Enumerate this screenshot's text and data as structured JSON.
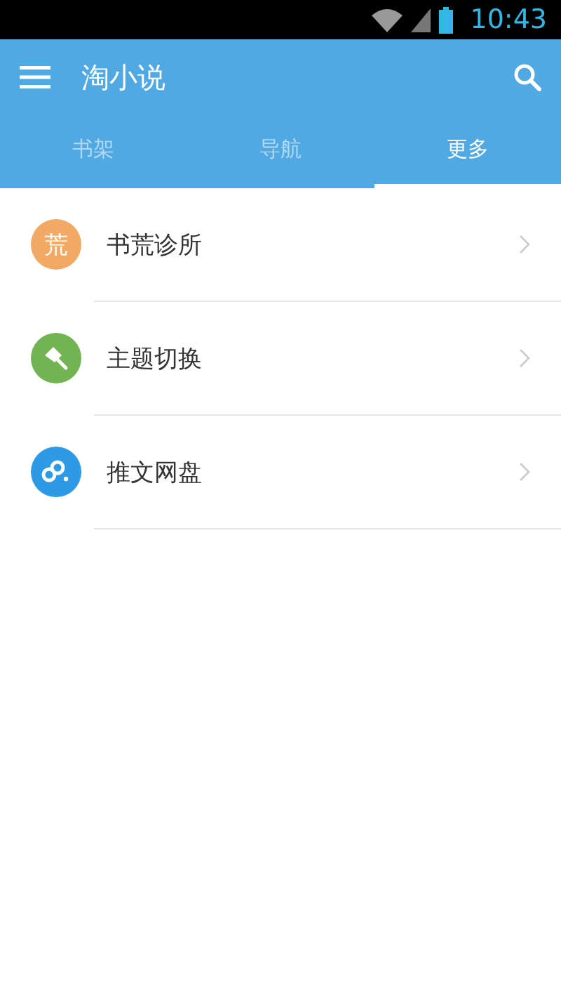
{
  "status_bar": {
    "time": "10:43"
  },
  "app_bar": {
    "title": "淘小说"
  },
  "tabs": [
    {
      "label": "书架",
      "selected": false
    },
    {
      "label": "导航",
      "selected": false
    },
    {
      "label": "更多",
      "selected": true
    }
  ],
  "items": [
    {
      "kind": "letter",
      "badge": "荒",
      "label": "书荒诊所",
      "color": "#f2a964"
    },
    {
      "kind": "brush",
      "label": "主题切换",
      "color": "#72b352"
    },
    {
      "kind": "link",
      "label": "推文网盘",
      "color": "#2e9ae6"
    }
  ]
}
